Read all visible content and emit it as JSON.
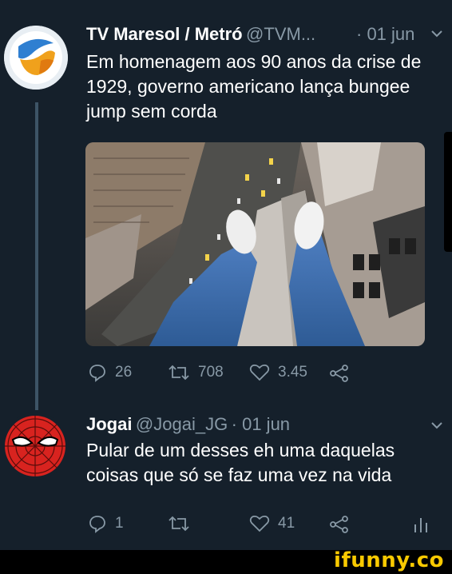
{
  "tweet1": {
    "name": "TV Maresol / Metró",
    "handle": "@TVM...",
    "time": "· 01 jun",
    "text_lines": [
      "Em homenagem aos 90 anos da crise de",
      "1929, governo americano lança bungee",
      "jump sem corda"
    ],
    "actions": {
      "replies": "26",
      "retweets": "708",
      "likes": "3.45"
    }
  },
  "tweet2": {
    "name": "Jogai",
    "handle": "@Jogai_JG",
    "time": "· 01 jun",
    "text_lines": [
      "Pular de um desses eh uma daquelas",
      "coisas que só se faz uma vez na vida"
    ],
    "actions": {
      "replies": "1",
      "retweets": "",
      "likes": "41"
    }
  },
  "watermark": "ifunny.co",
  "colors": {
    "background": "#15202b",
    "secondary_text": "#8899a6",
    "watermark": "#f9c900"
  }
}
